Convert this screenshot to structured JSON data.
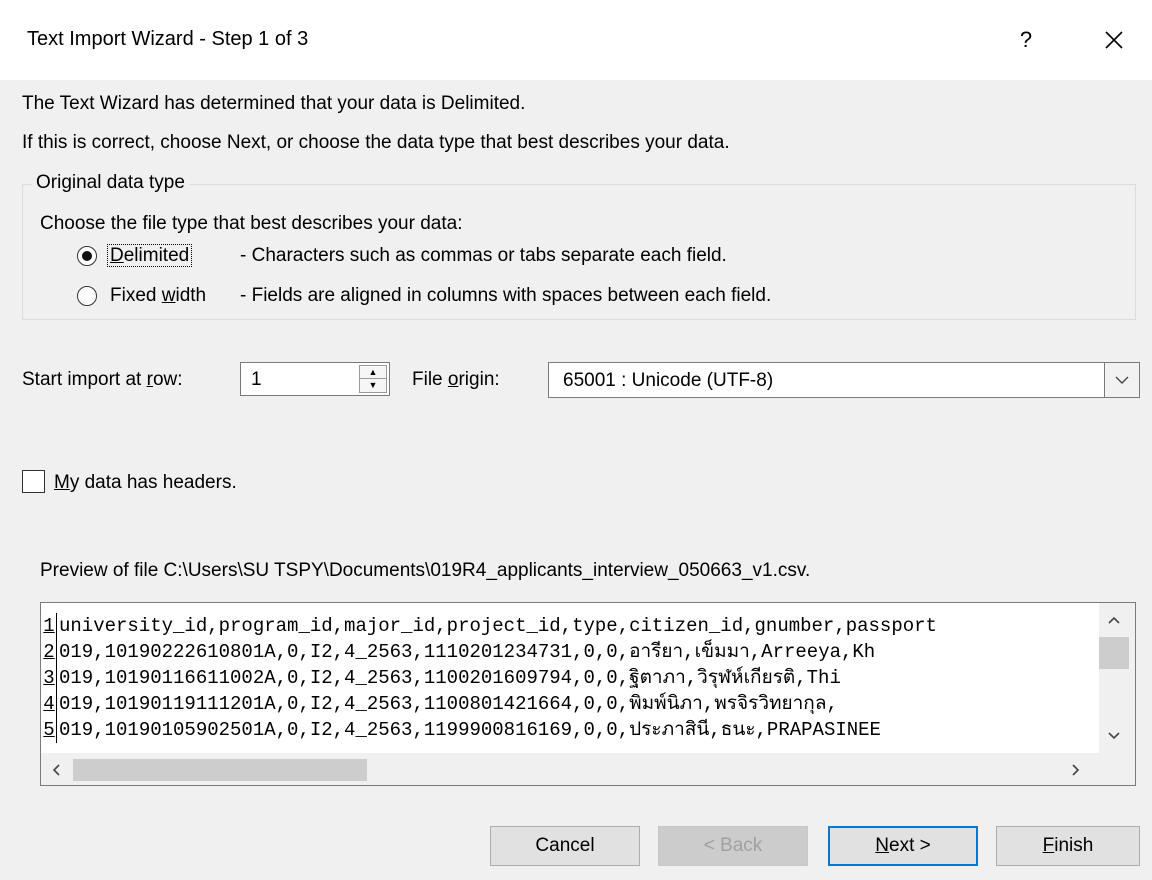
{
  "window": {
    "title": "Text Import Wizard - Step 1 of 3",
    "help": "?"
  },
  "intro": {
    "line1": "The Text Wizard has determined that your data is Delimited.",
    "line2": "If this is correct, choose Next, or choose the data type that best describes your data."
  },
  "data_type": {
    "legend": "Original data type",
    "prompt": "Choose the file type that best describes your data:",
    "options": [
      {
        "label_pre": "",
        "label_u": "D",
        "label_post": "elimited",
        "desc": "- Characters such as commas or tabs separate each field.",
        "selected": true
      },
      {
        "label_pre": "Fixed ",
        "label_u": "w",
        "label_post": "idth",
        "desc": "- Fields are aligned in columns with spaces between each field.",
        "selected": false
      }
    ]
  },
  "start_row": {
    "label_pre": "Start import at ",
    "label_u": "r",
    "label_post": "ow:",
    "value": "1"
  },
  "file_origin": {
    "label_pre": "File ",
    "label_u": "o",
    "label_post": "rigin:",
    "value": "65001 : Unicode (UTF-8)"
  },
  "headers": {
    "label_u": "M",
    "label_post": "y data has headers.",
    "checked": false
  },
  "preview": {
    "label": "Preview of file C:\\Users\\SU TSPY\\Documents\\019R4_applicants_interview_050663_v1.csv.",
    "rows": [
      {
        "num": "1",
        "text": "university_id,program_id,major_id,project_id,type,citizen_id,gnumber,passport"
      },
      {
        "num": "2",
        "text": "019,10190222610801A,0,I2,4_2563,1110201234731,0,0,อารียา,เข็มมา,Arreeya,Kh"
      },
      {
        "num": "3",
        "text": "019,10190116611002A,0,I2,4_2563,1100201609794,0,0,ฐิตาภา,วิรุฬห์เกียรติ,Thi"
      },
      {
        "num": "4",
        "text": "019,10190119111201A,0,I2,4_2563,1100801421664,0,0,พิมพ์นิภา,พรจิรวิทยากุล,"
      },
      {
        "num": "5",
        "text": "019,10190105902501A,0,I2,4_2563,1199900816169,0,0,ประภาสินี,ธนะ,PRAPASINEE"
      }
    ]
  },
  "buttons": {
    "cancel": "Cancel",
    "back": "< Back",
    "next_u": "N",
    "next_post": "ext >",
    "finish_u": "F",
    "finish_post": "inish"
  }
}
